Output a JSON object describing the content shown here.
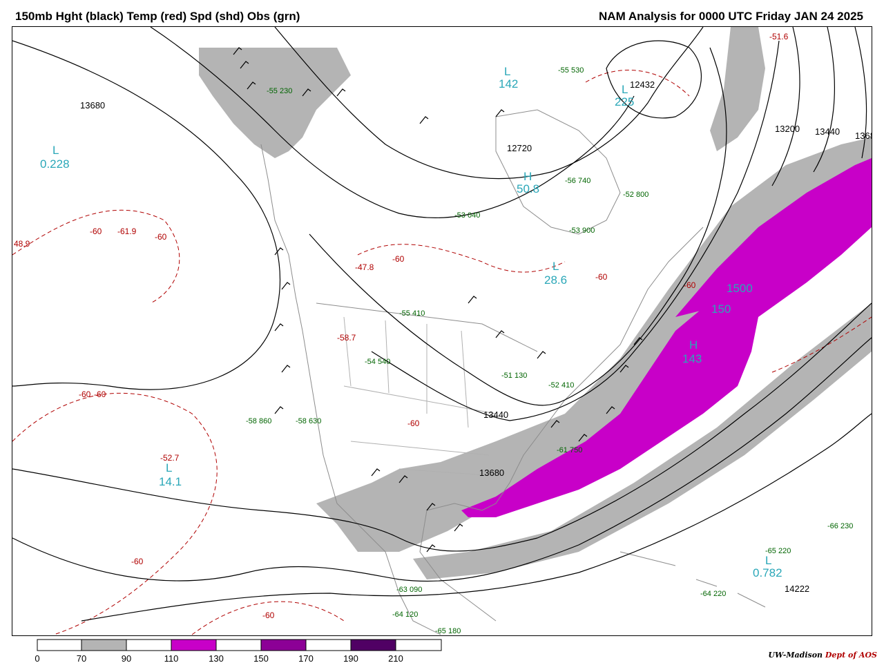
{
  "header": {
    "left_title": "150mb Hght (black) Temp (red) Spd (shd) Obs (grn)",
    "right_title": "NAM Analysis for 0000 UTC Friday  JAN 24 2025"
  },
  "colors": {
    "height_contour": "#000000",
    "temperature": "#b00000",
    "obs": "#006400",
    "pressure_center": "#2aa7b8",
    "speed_70_90": "#b4b4b4",
    "speed_110_130": "#c800c8",
    "speed_150_170": "#8c0096",
    "speed_190_210": "#500064"
  },
  "height_labels": [
    "13680",
    "12720",
    "13200",
    "13440",
    "1368",
    "13440",
    "13680",
    "14222",
    "12432"
  ],
  "pressure_centers": [
    {
      "letter": "L",
      "value": "0.228"
    },
    {
      "letter": "L",
      "value": "142"
    },
    {
      "letter": "L",
      "value": "225"
    },
    {
      "letter": "H",
      "value": "50.8"
    },
    {
      "letter": "L",
      "value": "28.6"
    },
    {
      "letter": "H",
      "value": "143"
    },
    {
      "letter": "L",
      "value": "14.1"
    },
    {
      "letter": "L",
      "value": "0.782"
    },
    {
      "letter": "H",
      "value": "1500"
    },
    {
      "letter": "H",
      "value": "150"
    }
  ],
  "temp_labels": [
    "-60",
    "-61.9",
    "-60",
    "48.9",
    "-47.8",
    "-60",
    "-58.7",
    "-60",
    "-60",
    "-52.7",
    "-60",
    "-60",
    "-60",
    "-60",
    "-60",
    "-51.6"
  ],
  "obs_labels": [
    "-55 530",
    "-53 040",
    "-55 230",
    "-53 900",
    "-52 800",
    "-55 410",
    "-54 540",
    "-51 130",
    "-52 410",
    "-56 740",
    "-58 860",
    "-64 120",
    "-66 230",
    "-65 220",
    "-64 220",
    "-63 090",
    "-65 180",
    "-61 750",
    "-58 630"
  ],
  "legend": {
    "ticks": [
      "0",
      "70",
      "90",
      "110",
      "130",
      "150",
      "170",
      "190",
      "210"
    ]
  },
  "credit": {
    "org": "UW-Madison",
    "dept": "Dept of AOS"
  }
}
